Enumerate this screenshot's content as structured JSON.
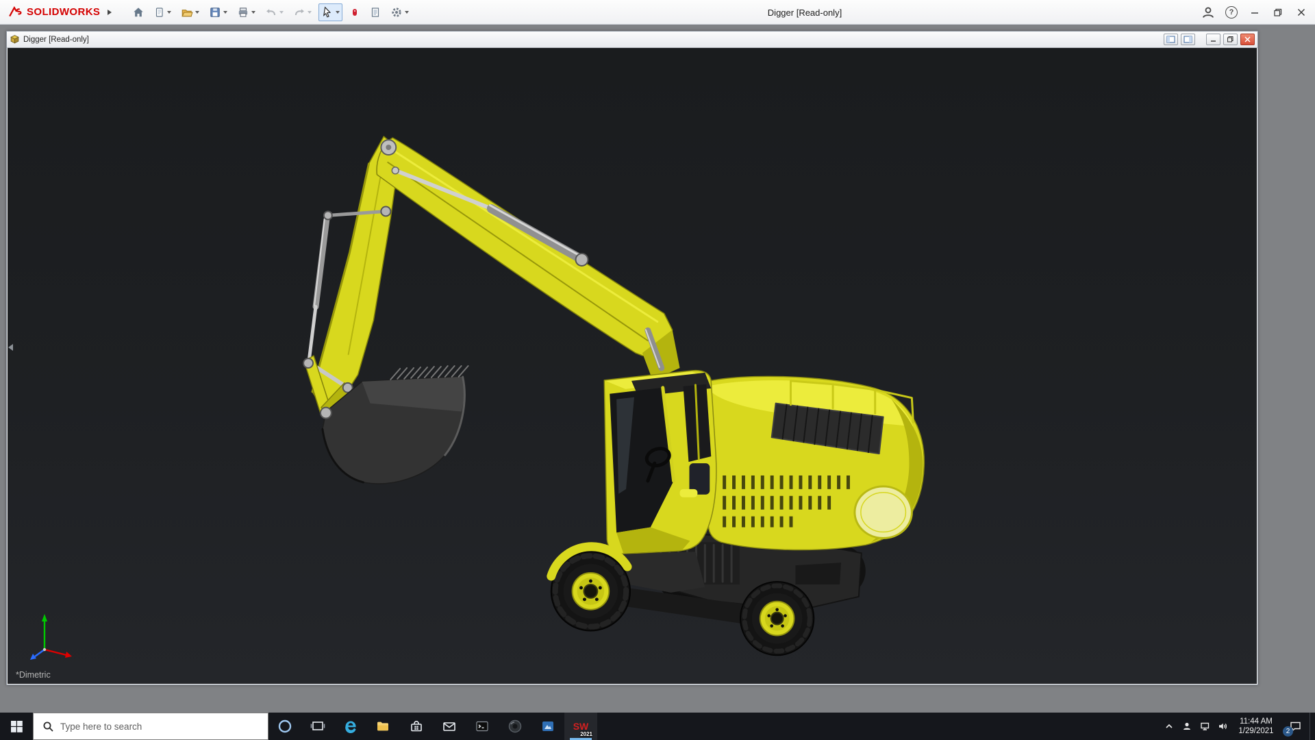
{
  "app_titlebar": {
    "brand": "SOLIDWORKS",
    "title": "Digger [Read-only]",
    "help_glyph": "?",
    "toolbar_icon_names": [
      "home",
      "new-document",
      "open",
      "save",
      "print",
      "undo",
      "redo",
      "select",
      "xpress-products",
      "file-properties",
      "options"
    ]
  },
  "document_window": {
    "title": "Digger [Read-only]",
    "orientation_label": "*Dimetric"
  },
  "taskbar": {
    "search_placeholder": "Type here to search",
    "time": "11:44 AM",
    "date": "1/29/2021",
    "notification_badge": "2",
    "solidworks_icon_text": "SW",
    "solidworks_icon_year": "2021"
  },
  "colors": {
    "brand_red": "#d40000",
    "model_yellow": "#d8d81e",
    "viewport_bg": "#1e2023",
    "taskbar_bg": "#15171c",
    "child_close_red": "#d9503a",
    "active_app_underline": "#76b9ed"
  }
}
